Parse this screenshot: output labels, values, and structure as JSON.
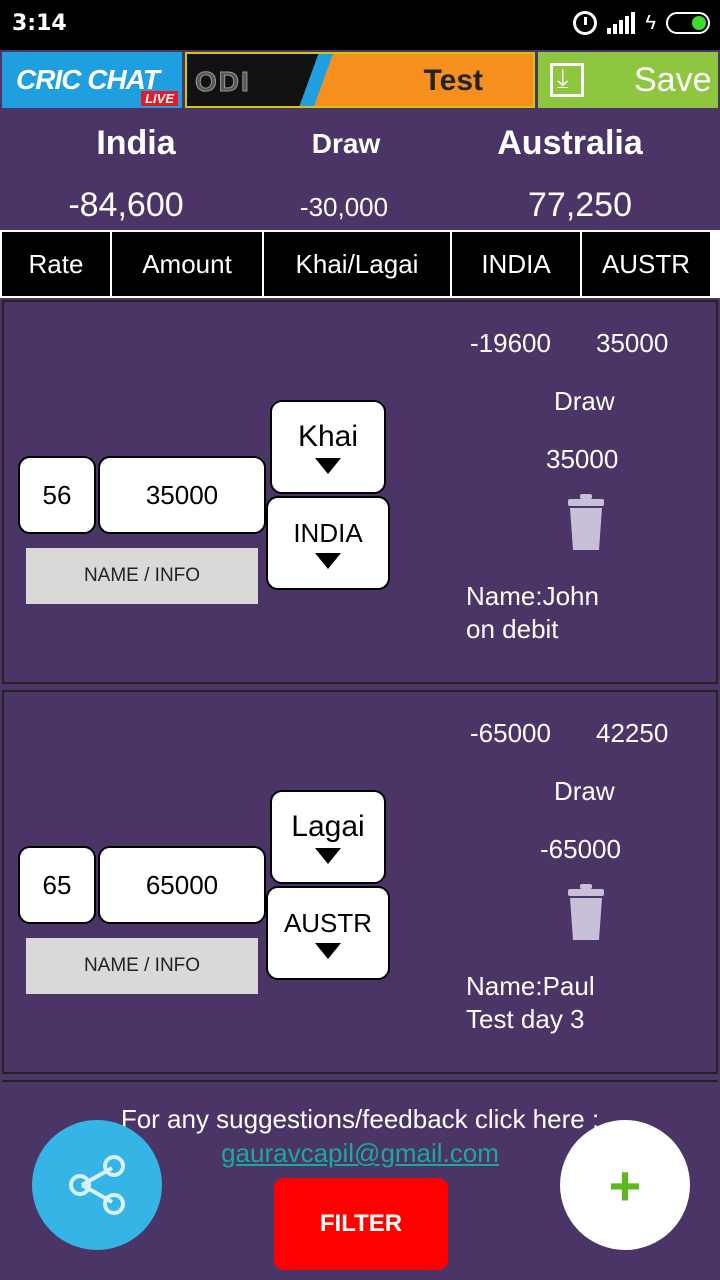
{
  "status_bar": {
    "time": "3:14"
  },
  "header": {
    "logo_text": "CRIC CHAT",
    "logo_badge": "LIVE",
    "format_options": [
      "ODI",
      "Test"
    ],
    "save_label": "Save"
  },
  "summary": {
    "teams": [
      {
        "name": "India",
        "value": "-84,600"
      },
      {
        "name": "Draw",
        "value": "-30,000"
      },
      {
        "name": "Australia",
        "value": "77,250"
      }
    ]
  },
  "columns": [
    "Rate",
    "Amount",
    "Khai/Lagai",
    "INDIA",
    "AUSTR"
  ],
  "entries": [
    {
      "rate": "56",
      "amount": "35000",
      "type": "Khai",
      "team": "INDIA",
      "name_button": "NAME / INFO",
      "india_value": "-19600",
      "austr_value": "35000",
      "draw_label": "Draw",
      "draw_value": "35000",
      "note_line1": "Name:John",
      "note_line2": "on debit"
    },
    {
      "rate": "65",
      "amount": "65000",
      "type": "Lagai",
      "team": "AUSTR",
      "name_button": "NAME / INFO",
      "india_value": "-65000",
      "austr_value": "42250",
      "draw_label": "Draw",
      "draw_value": "-65000",
      "note_line1": "Name:Paul",
      "note_line2": "Test day 3"
    }
  ],
  "footer": {
    "feedback_text": "For any suggestions/feedback click here :",
    "email": "gauravcapil@gmail.com",
    "filter_label": "FILTER",
    "add_label": "+"
  }
}
